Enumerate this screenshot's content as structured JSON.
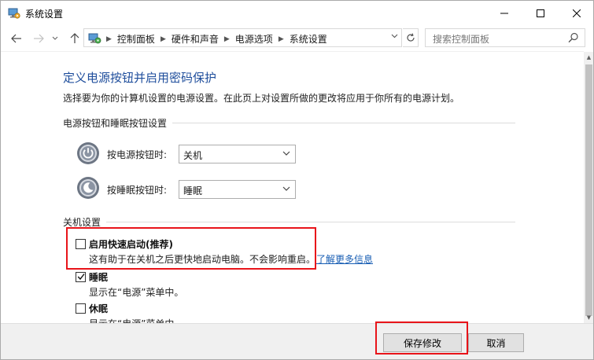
{
  "window": {
    "title": "系统设置",
    "minimize_icon": "minimize-icon",
    "maximize_icon": "maximize-icon",
    "close_icon": "close-icon"
  },
  "nav": {
    "back_icon": "arrow-left-icon",
    "forward_icon": "arrow-right-icon",
    "recent_icon": "chevron-down-icon",
    "up_icon": "arrow-up-icon",
    "breadcrumbs": [
      "控制面板",
      "硬件和声音",
      "电源选项",
      "系统设置"
    ],
    "refresh_icon": "refresh-icon"
  },
  "search": {
    "placeholder": "搜索控制面板",
    "icon": "search-icon"
  },
  "page": {
    "heading": "定义电源按钮并启用密码保护",
    "description": "选择要为你的计算机设置的电源设置。在此页上对设置所做的更改将应用于你所有的电源计划。",
    "power_section": {
      "label": "电源按钮和睡眠按钮设置",
      "rows": [
        {
          "label": "按电源按钮时:",
          "value": "关机",
          "icon": "power-button-icon"
        },
        {
          "label": "按睡眠按钮时:",
          "value": "睡眠",
          "icon": "sleep-button-icon"
        }
      ]
    },
    "shutdown_section": {
      "label": "关机设置",
      "options": [
        {
          "title": "启用快速启动(推荐)",
          "desc": "这有助于在关机之后更快地启动电脑。不会影响重启。",
          "link": "了解更多信息",
          "checked": false
        },
        {
          "title": "睡眠",
          "desc": "显示在“电源”菜单中。",
          "checked": true
        },
        {
          "title": "休眠",
          "desc": "显示在“电源”菜单中。",
          "checked": false
        }
      ]
    }
  },
  "footer": {
    "save_label": "保存修改",
    "cancel_label": "取消"
  },
  "colors": {
    "heading": "#1f4e9c",
    "link": "#1a5fb4",
    "highlight": "#e8141a"
  }
}
